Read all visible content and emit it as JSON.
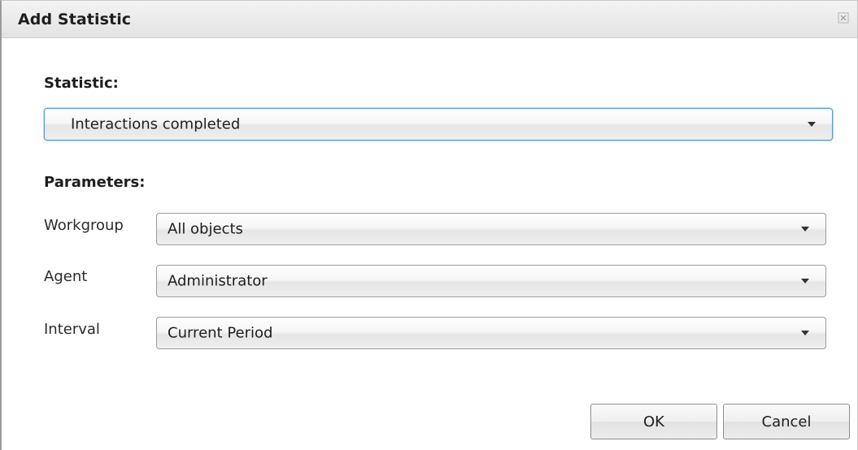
{
  "dialog": {
    "title": "Add Statistic",
    "close_icon": "close-icon"
  },
  "statistic": {
    "section_label": "Statistic:",
    "selected": "Interactions completed"
  },
  "parameters": {
    "section_label": "Parameters:",
    "fields": [
      {
        "label": "Workgroup",
        "selected": "All objects"
      },
      {
        "label": "Agent",
        "selected": "Administrator"
      },
      {
        "label": "Interval",
        "selected": "Current Period"
      }
    ]
  },
  "buttons": {
    "ok_label": "OK",
    "cancel_label": "Cancel"
  },
  "colors": {
    "focus_border": "#5b9bd5",
    "title_bar": "#e8e8e8"
  }
}
